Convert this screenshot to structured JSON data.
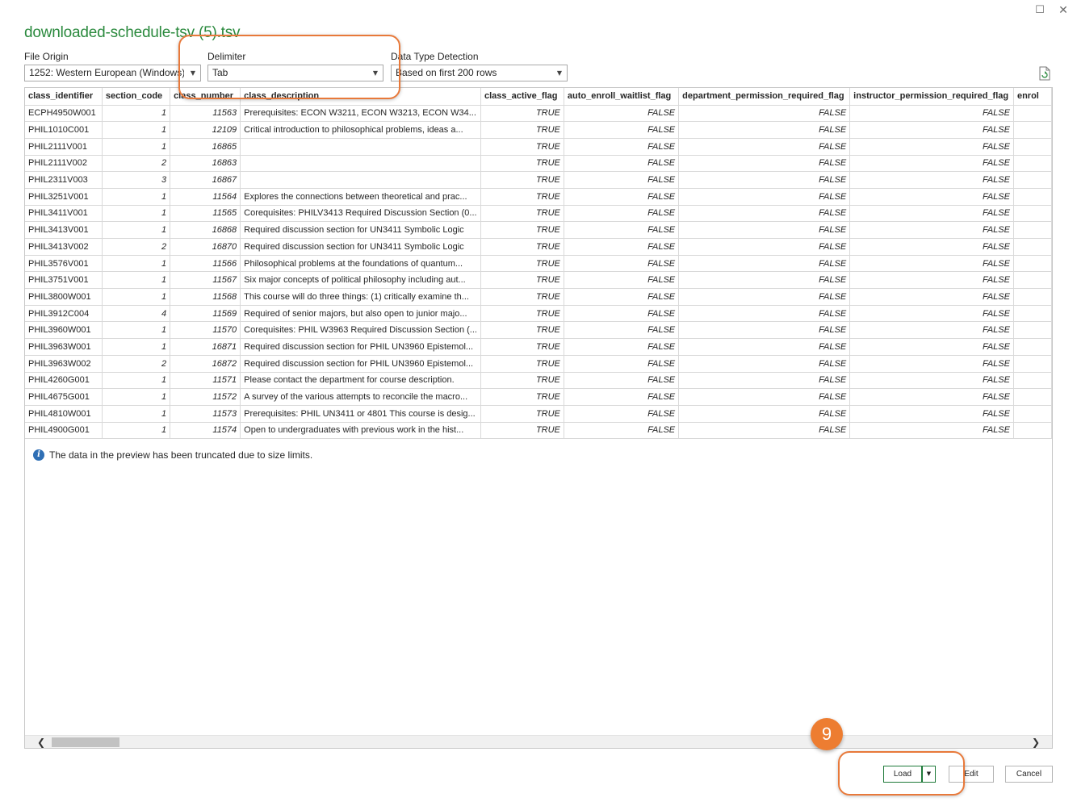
{
  "window": {
    "title": "downloaded-schedule-tsv (5).tsv",
    "maximize_glyph": "☐",
    "close_glyph": "✕"
  },
  "options": {
    "file_origin": {
      "label": "File Origin",
      "value": "1252: Western European (Windows)"
    },
    "delimiter": {
      "label": "Delimiter",
      "value": "Tab"
    },
    "data_type_detection": {
      "label": "Data Type Detection",
      "value": "Based on first 200 rows"
    }
  },
  "icons": {
    "refresh": "refresh-preview-icon",
    "info": "info-icon"
  },
  "table": {
    "columns": [
      "class_identifier",
      "section_code",
      "class_number",
      "class_description",
      "class_active_flag",
      "auto_enroll_waitlist_flag",
      "department_permission_required_flag",
      "instructor_permission_required_flag",
      "enrol"
    ],
    "rows": [
      [
        "ECPH4950W001",
        "1",
        "11563",
        "Prerequisites: ECON W3211, ECON W3213, ECON W34...",
        "TRUE",
        "FALSE",
        "FALSE",
        "FALSE"
      ],
      [
        "PHIL1010C001",
        "1",
        "12109",
        "Critical introduction to philosophical problems, ideas a...",
        "TRUE",
        "FALSE",
        "FALSE",
        "FALSE"
      ],
      [
        "PHIL2111V001",
        "1",
        "16865",
        "",
        "TRUE",
        "FALSE",
        "FALSE",
        "FALSE"
      ],
      [
        "PHIL2111V002",
        "2",
        "16863",
        "",
        "TRUE",
        "FALSE",
        "FALSE",
        "FALSE"
      ],
      [
        "PHIL2311V003",
        "3",
        "16867",
        "",
        "TRUE",
        "FALSE",
        "FALSE",
        "FALSE"
      ],
      [
        "PHIL3251V001",
        "1",
        "11564",
        "Explores the connections between theoretical and prac...",
        "TRUE",
        "FALSE",
        "FALSE",
        "FALSE"
      ],
      [
        "PHIL3411V001",
        "1",
        "11565",
        "Corequisites: PHILV3413 Required Discussion Section (0...",
        "TRUE",
        "FALSE",
        "FALSE",
        "FALSE"
      ],
      [
        "PHIL3413V001",
        "1",
        "16868",
        "Required discussion section for UN3411 Symbolic Logic",
        "TRUE",
        "FALSE",
        "FALSE",
        "FALSE"
      ],
      [
        "PHIL3413V002",
        "2",
        "16870",
        "Required discussion section for UN3411 Symbolic Logic",
        "TRUE",
        "FALSE",
        "FALSE",
        "FALSE"
      ],
      [
        "PHIL3576V001",
        "1",
        "11566",
        "Philosophical problems at the foundations of quantum...",
        "TRUE",
        "FALSE",
        "FALSE",
        "FALSE"
      ],
      [
        "PHIL3751V001",
        "1",
        "11567",
        "Six major concepts of political philosophy including aut...",
        "TRUE",
        "FALSE",
        "FALSE",
        "FALSE"
      ],
      [
        "PHIL3800W001",
        "1",
        "11568",
        "This course will do three things: (1) critically examine th...",
        "TRUE",
        "FALSE",
        "FALSE",
        "FALSE"
      ],
      [
        "PHIL3912C004",
        "4",
        "11569",
        "Required of senior majors, but also open to junior majo...",
        "TRUE",
        "FALSE",
        "FALSE",
        "FALSE"
      ],
      [
        "PHIL3960W001",
        "1",
        "11570",
        "Corequisites: PHIL W3963 Required Discussion Section (...",
        "TRUE",
        "FALSE",
        "FALSE",
        "FALSE"
      ],
      [
        "PHIL3963W001",
        "1",
        "16871",
        "Required discussion section for PHIL UN3960 Epistemol...",
        "TRUE",
        "FALSE",
        "FALSE",
        "FALSE"
      ],
      [
        "PHIL3963W002",
        "2",
        "16872",
        "Required discussion section for PHIL UN3960 Epistemol...",
        "TRUE",
        "FALSE",
        "FALSE",
        "FALSE"
      ],
      [
        "PHIL4260G001",
        "1",
        "11571",
        "Please contact the department for course description.",
        "TRUE",
        "FALSE",
        "FALSE",
        "FALSE"
      ],
      [
        "PHIL4675G001",
        "1",
        "11572",
        "A survey of the various attempts to reconcile the macro...",
        "TRUE",
        "FALSE",
        "FALSE",
        "FALSE"
      ],
      [
        "PHIL4810W001",
        "1",
        "11573",
        "Prerequisites: PHIL UN3411 or 4801 This course is desig...",
        "TRUE",
        "FALSE",
        "FALSE",
        "FALSE"
      ],
      [
        "PHIL4900G001",
        "1",
        "11574",
        "Open to undergraduates with previous work in the hist...",
        "TRUE",
        "FALSE",
        "FALSE",
        "FALSE"
      ]
    ],
    "truncated_notice": "The data in the preview has been truncated due to size limits."
  },
  "scrollbar": {
    "left_glyph": "❮",
    "right_glyph": "❯"
  },
  "buttons": {
    "load": "Load",
    "load_dropdown_glyph": "▼",
    "edit": "Edit",
    "cancel": "Cancel"
  },
  "annotations": {
    "step_number": "9",
    "highlight_color": "#e8793a"
  },
  "colors": {
    "title": "#2b8a3e",
    "accent_button_border": "#1f7a3a",
    "info_icon": "#2f6fb5",
    "step_badge": "#ed7d31"
  }
}
